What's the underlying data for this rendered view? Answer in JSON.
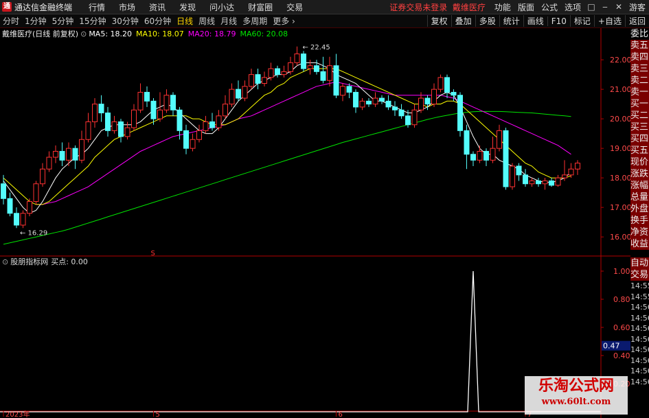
{
  "app": {
    "title": "通达信金融终端",
    "logo": "TDX"
  },
  "menu": [
    "行情",
    "市场",
    "资讯",
    "发现",
    "问小达",
    "财富圈",
    "交易"
  ],
  "status": {
    "notice": "证券交易未登录",
    "stock": "戴维医疗"
  },
  "right_menu": [
    "功能",
    "版面",
    "公式",
    "选项"
  ],
  "window_buttons": [
    "□",
    "‒",
    "✕"
  ],
  "guest": "游客",
  "periods": [
    "分时",
    "1分钟",
    "5分钟",
    "15分钟",
    "30分钟",
    "60分钟",
    "日线",
    "周线",
    "月线",
    "多周期",
    "更多 ›"
  ],
  "active_period": "日线",
  "tool_buttons": [
    "复权",
    "叠加",
    "多股",
    "统计",
    "画线",
    "F10",
    "标记",
    "+自选",
    "返回"
  ],
  "main_info": {
    "title": "戴维医疗(日线 前复权)",
    "ma5": "MA5: 18.20",
    "ma10": "MA10: 18.07",
    "ma20": "MA20: 18.79",
    "ma60": "MA60: 20.08"
  },
  "sub_info": {
    "title": "股朋指标网",
    "value": "买点: 0.00"
  },
  "sidebar_main": [
    "委比",
    "卖五",
    "卖四",
    "卖三",
    "卖二",
    "卖一",
    "买一",
    "买二",
    "买三",
    "买四",
    "买五",
    "现价",
    "涨跌",
    "涨幅",
    "总量",
    "外盘",
    "换手",
    "净资",
    "收益"
  ],
  "sidebar_sub": [
    "自动",
    "交易"
  ],
  "sidebar_times": [
    "14:55",
    "14:55",
    "14:56",
    "14:56",
    "14:56",
    "14:56",
    "14:56",
    "14:56",
    "14:56",
    "14:56"
  ],
  "colors": {
    "up": "#ff3232",
    "down": "#54fcfc",
    "ma5": "#ffffff",
    "ma10": "#ffff00",
    "ma20": "#ff00ff",
    "ma60": "#00e600",
    "axis": "#b40000"
  },
  "chart_data": {
    "type": "candlestick",
    "price_axis": {
      "ticks": [
        16.0,
        17.0,
        18.0,
        19.0,
        20.0,
        21.0,
        22.0
      ],
      "range": [
        15.4,
        22.7
      ]
    },
    "high_label": "22.45",
    "low_label": "16.29",
    "candles": [
      [
        17.8,
        17.3,
        18.1,
        17.1
      ],
      [
        17.3,
        16.8,
        17.5,
        16.7
      ],
      [
        16.8,
        16.4,
        17.0,
        16.3
      ],
      [
        16.4,
        16.8,
        16.9,
        16.3
      ],
      [
        16.8,
        17.2,
        17.3,
        16.7
      ],
      [
        17.2,
        17.8,
        17.9,
        17.1
      ],
      [
        17.8,
        18.3,
        18.5,
        17.7
      ],
      [
        18.3,
        18.7,
        18.9,
        18.2
      ],
      [
        18.7,
        18.9,
        19.1,
        18.5
      ],
      [
        18.9,
        18.6,
        19.2,
        18.4
      ],
      [
        18.6,
        19.0,
        19.2,
        18.4
      ],
      [
        19.0,
        18.6,
        19.1,
        18.3
      ],
      [
        18.6,
        19.3,
        19.6,
        18.5
      ],
      [
        19.3,
        19.9,
        20.2,
        19.2
      ],
      [
        19.9,
        20.5,
        20.7,
        19.7
      ],
      [
        20.5,
        20.2,
        20.8,
        19.9
      ],
      [
        20.2,
        19.6,
        20.4,
        19.4
      ],
      [
        19.6,
        19.9,
        20.1,
        19.5
      ],
      [
        19.9,
        19.4,
        20.0,
        19.2
      ],
      [
        19.4,
        19.7,
        19.9,
        19.3
      ],
      [
        19.7,
        20.3,
        20.5,
        19.6
      ],
      [
        20.3,
        20.9,
        21.2,
        20.2
      ],
      [
        20.9,
        20.6,
        21.1,
        20.4
      ],
      [
        20.6,
        20.0,
        20.7,
        19.8
      ],
      [
        20.0,
        20.3,
        20.9,
        19.9
      ],
      [
        20.3,
        20.8,
        21.0,
        20.2
      ],
      [
        20.8,
        20.3,
        20.9,
        20.1
      ],
      [
        20.3,
        19.6,
        20.4,
        19.3
      ],
      [
        19.6,
        19.0,
        19.8,
        18.8
      ],
      [
        19.0,
        19.3,
        19.5,
        18.9
      ],
      [
        19.3,
        19.6,
        19.8,
        19.2
      ],
      [
        19.6,
        19.9,
        20.1,
        19.5
      ],
      [
        19.9,
        19.7,
        20.2,
        19.6
      ],
      [
        19.7,
        20.1,
        20.3,
        19.6
      ],
      [
        20.1,
        20.5,
        20.8,
        20.0
      ],
      [
        20.5,
        21.0,
        21.2,
        20.4
      ],
      [
        21.0,
        20.7,
        21.3,
        20.6
      ],
      [
        20.7,
        21.1,
        21.3,
        20.6
      ],
      [
        21.1,
        21.5,
        21.7,
        21.0
      ],
      [
        21.5,
        21.2,
        21.7,
        21.0
      ],
      [
        21.2,
        21.4,
        21.6,
        21.1
      ],
      [
        21.4,
        21.7,
        21.9,
        21.3
      ],
      [
        21.7,
        21.5,
        21.8,
        21.4
      ],
      [
        21.5,
        21.6,
        21.8,
        21.4
      ],
      [
        21.6,
        21.9,
        22.1,
        21.5
      ],
      [
        21.9,
        22.2,
        22.45,
        21.8
      ],
      [
        22.2,
        21.7,
        22.3,
        21.6
      ],
      [
        21.7,
        21.8,
        22.0,
        21.5
      ],
      [
        21.8,
        21.6,
        22.0,
        21.5
      ],
      [
        21.6,
        21.3,
        22.1,
        21.2
      ],
      [
        21.3,
        21.8,
        22.1,
        21.1
      ],
      [
        21.8,
        20.8,
        22.2,
        20.7
      ],
      [
        20.8,
        21.1,
        21.2,
        20.6
      ],
      [
        21.1,
        20.9,
        21.2,
        20.7
      ],
      [
        20.9,
        20.4,
        21.0,
        20.2
      ],
      [
        20.4,
        20.6,
        20.7,
        20.3
      ],
      [
        20.6,
        20.5,
        20.7,
        20.4
      ],
      [
        20.5,
        20.7,
        20.9,
        20.4
      ],
      [
        20.7,
        20.6,
        20.8,
        20.5
      ],
      [
        20.6,
        20.4,
        20.8,
        20.3
      ],
      [
        20.4,
        20.3,
        20.6,
        20.1
      ],
      [
        20.3,
        20.1,
        20.5,
        20.0
      ],
      [
        20.1,
        19.8,
        20.3,
        19.7
      ],
      [
        19.8,
        20.3,
        20.5,
        19.7
      ],
      [
        20.3,
        20.7,
        20.9,
        20.2
      ],
      [
        20.7,
        20.5,
        20.8,
        20.3
      ],
      [
        20.5,
        21.0,
        21.2,
        20.4
      ],
      [
        21.0,
        21.4,
        21.5,
        20.9
      ],
      [
        21.4,
        20.9,
        21.5,
        20.7
      ],
      [
        20.9,
        20.8,
        21.0,
        20.6
      ],
      [
        20.8,
        19.6,
        20.9,
        19.4
      ],
      [
        19.6,
        18.8,
        19.8,
        18.3
      ],
      [
        18.8,
        18.6,
        18.9,
        18.4
      ],
      [
        18.6,
        18.9,
        19.1,
        18.5
      ],
      [
        18.9,
        18.6,
        19.0,
        18.4
      ],
      [
        18.6,
        19.0,
        19.4,
        18.5
      ],
      [
        19.0,
        19.6,
        19.8,
        18.9
      ],
      [
        19.6,
        17.7,
        19.7,
        17.6
      ],
      [
        17.7,
        18.4,
        18.5,
        17.6
      ],
      [
        18.4,
        18.1,
        18.5,
        17.9
      ],
      [
        18.1,
        17.8,
        18.3,
        17.7
      ],
      [
        17.8,
        17.9,
        18.0,
        17.7
      ],
      [
        17.9,
        17.8,
        18.0,
        17.7
      ],
      [
        17.8,
        17.9,
        18.0,
        17.6
      ],
      [
        17.9,
        17.75,
        18.0,
        17.7
      ],
      [
        17.75,
        18.0,
        18.1,
        17.7
      ],
      [
        18.0,
        18.1,
        18.6,
        17.9
      ],
      [
        18.1,
        18.3,
        18.5,
        18.0
      ],
      [
        18.3,
        18.5,
        18.6,
        18.1
      ]
    ],
    "ma5": [
      17.9,
      17.6,
      17.3,
      17.0,
      16.8,
      16.9,
      17.2,
      17.6,
      18.0,
      18.3,
      18.5,
      18.7,
      18.8,
      19.0,
      19.3,
      19.6,
      19.7,
      19.8,
      19.8,
      19.8,
      19.8,
      19.9,
      20.1,
      20.3,
      20.4,
      20.5,
      20.4,
      20.2,
      20.0,
      19.8,
      19.6,
      19.5,
      19.5,
      19.7,
      20.0,
      20.3,
      20.6,
      20.8,
      21.0,
      21.2,
      21.3,
      21.4,
      21.5,
      21.5,
      21.6,
      21.8,
      21.9,
      21.9,
      21.9,
      21.8,
      21.7,
      21.5,
      21.4,
      21.3,
      21.2,
      21.0,
      20.8,
      20.6,
      20.6,
      20.5,
      20.4,
      20.3,
      20.2,
      20.2,
      20.3,
      20.4,
      20.6,
      20.8,
      20.9,
      20.8,
      20.4,
      19.9,
      19.4,
      19.0,
      18.8,
      18.8,
      18.6,
      18.5,
      18.4,
      18.3,
      18.1,
      18.0,
      17.9,
      17.85,
      17.85,
      17.9,
      18.0,
      18.2
    ],
    "ma10": [
      18.0,
      17.8,
      17.6,
      17.4,
      17.2,
      17.1,
      17.1,
      17.2,
      17.4,
      17.6,
      17.8,
      18.0,
      18.2,
      18.4,
      18.7,
      18.9,
      19.1,
      19.3,
      19.4,
      19.5,
      19.6,
      19.7,
      19.8,
      19.9,
      20.0,
      20.1,
      20.1,
      20.1,
      20.1,
      20.0,
      20.0,
      19.9,
      19.8,
      19.8,
      19.8,
      19.9,
      20.0,
      20.2,
      20.4,
      20.6,
      20.8,
      20.9,
      21.1,
      21.2,
      21.4,
      21.5,
      21.6,
      21.7,
      21.7,
      21.7,
      21.7,
      21.7,
      21.6,
      21.5,
      21.4,
      21.3,
      21.2,
      21.1,
      21.0,
      20.9,
      20.8,
      20.7,
      20.6,
      20.5,
      20.5,
      20.4,
      20.5,
      20.5,
      20.6,
      20.6,
      20.5,
      20.3,
      20.1,
      19.9,
      19.7,
      19.5,
      19.3,
      19.1,
      18.9,
      18.7,
      18.5,
      18.4,
      18.2,
      18.1,
      18.0,
      18.0,
      18.0,
      18.07
    ],
    "ma20": [
      null,
      null,
      null,
      null,
      null,
      17.1,
      17.1,
      17.15,
      17.2,
      17.3,
      17.4,
      17.5,
      17.6,
      17.7,
      17.85,
      18.0,
      18.15,
      18.3,
      18.45,
      18.6,
      18.75,
      18.9,
      19.0,
      19.1,
      19.2,
      19.3,
      19.4,
      19.45,
      19.5,
      19.55,
      19.6,
      19.65,
      19.7,
      19.75,
      19.8,
      19.9,
      20.0,
      20.05,
      20.1,
      20.2,
      20.3,
      20.4,
      20.5,
      20.6,
      20.7,
      20.8,
      20.9,
      21.0,
      21.1,
      21.15,
      21.2,
      21.25,
      21.2,
      21.15,
      21.1,
      21.05,
      21.0,
      20.95,
      20.9,
      20.85,
      20.8,
      20.8,
      20.8,
      20.8,
      20.8,
      20.8,
      20.8,
      20.8,
      20.75,
      20.7,
      20.6,
      20.5,
      20.4,
      20.3,
      20.2,
      20.1,
      20.0,
      19.9,
      19.8,
      19.7,
      19.6,
      19.5,
      19.4,
      19.3,
      19.2,
      19.1,
      18.95,
      18.8
    ],
    "ma60": [
      15.75,
      15.8,
      15.85,
      15.9,
      15.95,
      16.0,
      16.05,
      16.1,
      16.15,
      16.2,
      16.26,
      16.33,
      16.4,
      16.47,
      16.54,
      16.61,
      16.68,
      16.75,
      16.82,
      16.89,
      16.96,
      17.03,
      17.1,
      17.17,
      17.24,
      17.31,
      17.38,
      17.45,
      17.52,
      17.59,
      17.66,
      17.73,
      17.8,
      17.87,
      17.94,
      18.01,
      18.08,
      18.15,
      18.22,
      18.29,
      18.36,
      18.43,
      18.5,
      18.57,
      18.64,
      18.71,
      18.78,
      18.85,
      18.92,
      18.99,
      19.06,
      19.13,
      19.2,
      19.26,
      19.32,
      19.38,
      19.44,
      19.5,
      19.56,
      19.62,
      19.68,
      19.74,
      19.8,
      19.86,
      19.92,
      19.98,
      20.03,
      20.08,
      20.12,
      20.16,
      20.2,
      20.22,
      20.24,
      20.25,
      20.25,
      20.25,
      20.25,
      20.24,
      20.23,
      20.22,
      20.21,
      20.2,
      20.18,
      20.16,
      20.14,
      20.12,
      20.1,
      20.08
    ],
    "x_labels": [
      {
        "label": "2023年",
        "index": 0
      },
      {
        "label": "5",
        "index": 23
      },
      {
        "label": "6",
        "index": 51
      },
      {
        "label": "7",
        "index": 80
      }
    ],
    "indicator": {
      "name": "买点",
      "ticks": [
        0.2,
        0.4,
        0.6,
        0.8,
        1.0
      ],
      "cursor_value": "0.47",
      "signal_index": 72,
      "signal_value": 1.0
    }
  }
}
